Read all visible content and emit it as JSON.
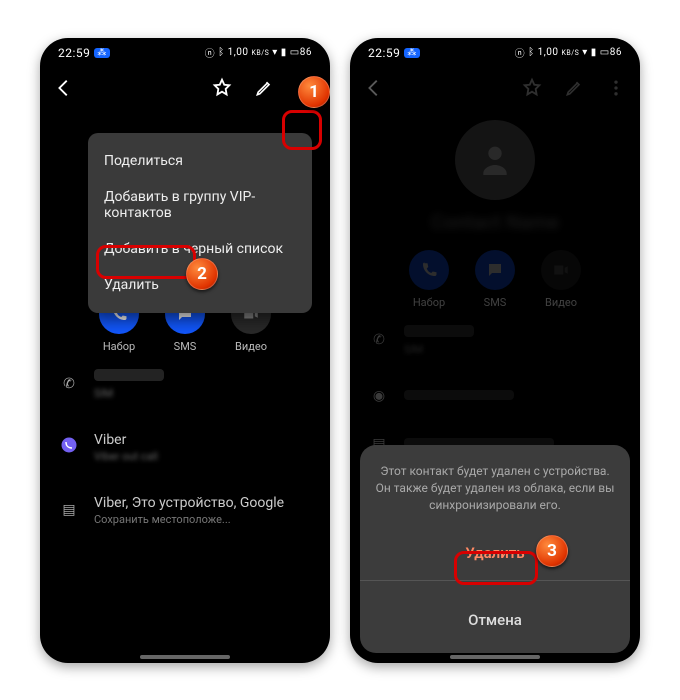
{
  "status": {
    "time": "22:59",
    "net_label": "1,00",
    "net_unit": "KB/S",
    "battery": "86"
  },
  "menu": {
    "share": "Поделиться",
    "add_vip": "Добавить в группу VIP-контактов",
    "add_blacklist": "Добавить в черный список",
    "delete": "Удалить"
  },
  "actions": {
    "call": "Набор",
    "sms": "SMS",
    "video": "Видео"
  },
  "rows": {
    "viber": "Viber",
    "storage": "Viber, Это устройство, Google",
    "storage_sub": "Сохранить местоположе..."
  },
  "dialog": {
    "message": "Этот контакт будет удален с устройства.\nОн также будет удален из облака, если вы\nсинхронизировали его.",
    "delete": "Удалить",
    "cancel": "Отмена"
  },
  "markers": {
    "one": "1",
    "two": "2",
    "three": "3"
  },
  "icons": {
    "back": "back-arrow",
    "star": "star-outline",
    "edit": "pencil",
    "more": "more-vert",
    "phone": "phone",
    "sms": "chat",
    "video": "videocam",
    "viber": "viber-logo",
    "sim": "sim-card"
  }
}
